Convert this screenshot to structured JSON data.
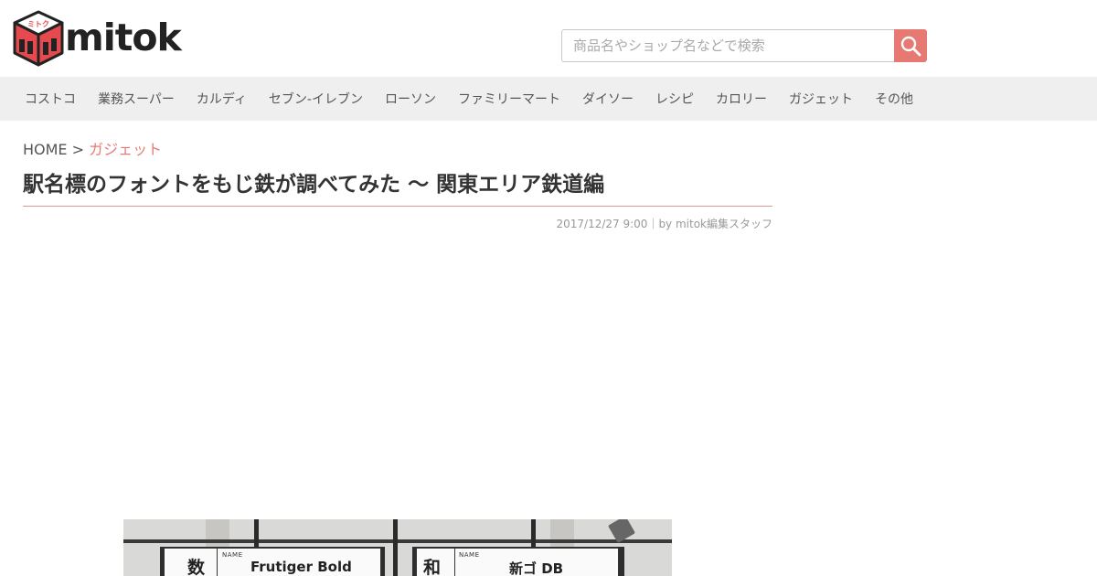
{
  "brand": {
    "logo_name": "mitok",
    "logo_kana": "ミトク",
    "accent": "#e67a73"
  },
  "search": {
    "placeholder": "商品名やショップ名などで検索",
    "value": "",
    "icon": "search-icon"
  },
  "nav": {
    "items": [
      {
        "label": "コストコ"
      },
      {
        "label": "業務スーパー"
      },
      {
        "label": "カルディ"
      },
      {
        "label": "セブン-イレブン"
      },
      {
        "label": "ローソン"
      },
      {
        "label": "ファミリーマート"
      },
      {
        "label": "ダイソー"
      },
      {
        "label": "レシピ"
      },
      {
        "label": "カロリー"
      },
      {
        "label": "ガジェット"
      },
      {
        "label": "その他"
      }
    ]
  },
  "breadcrumb": {
    "home": "HOME",
    "separator": ">",
    "current": "ガジェット"
  },
  "article": {
    "title": "駅名標のフォントをもじ鉄が調べてみた 〜 関東エリア鉄道編",
    "meta": "2017/12/27 9:00｜by mitok編集スタッフ"
  },
  "hero": {
    "signs": [
      {
        "kanji": "数",
        "tag": "NAME",
        "font": "Frutiger Bold"
      },
      {
        "kanji": "和",
        "tag": "NAME",
        "font": "新ゴ DB"
      }
    ]
  }
}
